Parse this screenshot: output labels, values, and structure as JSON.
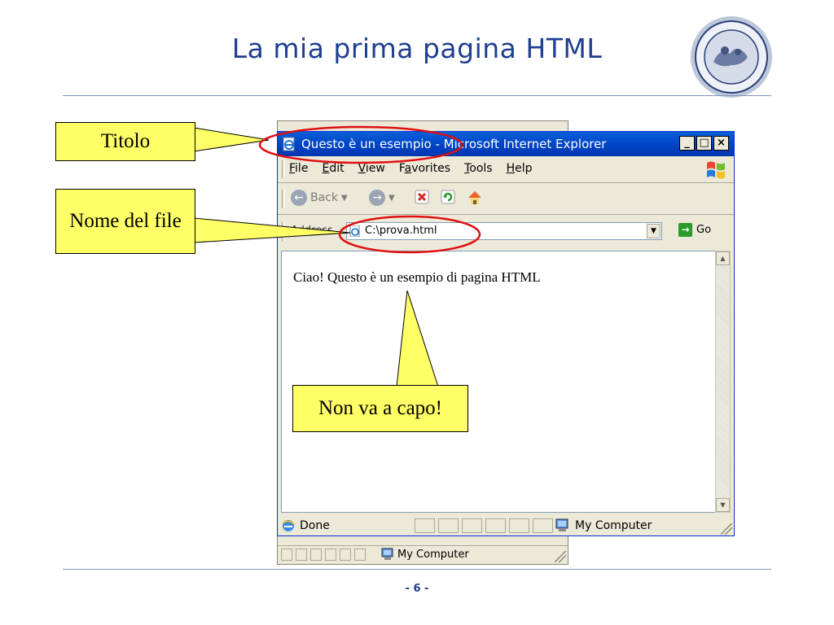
{
  "slide": {
    "title": "La mia prima pagina HTML",
    "page_number": "- 6 -"
  },
  "back_window": {
    "status_text": "My Computer"
  },
  "browser": {
    "title": "Questo è un esempio - Microsoft Internet Explorer",
    "window_buttons": {
      "minimize": "_",
      "maximize": "□",
      "close": "×"
    },
    "menu": {
      "items": [
        {
          "key": "F",
          "rest": "ile"
        },
        {
          "key": "E",
          "rest": "dit"
        },
        {
          "key": "V",
          "rest": "iew"
        },
        {
          "pre": "F",
          "key": "a",
          "rest": "vorites"
        },
        {
          "key": "T",
          "rest": "ools"
        },
        {
          "key": "H",
          "rest": "elp"
        }
      ]
    },
    "toolbar": {
      "back_label": "Back"
    },
    "address": {
      "label": "Address",
      "value": "C:\\prova.html",
      "go_label": "Go"
    },
    "content_text": "Ciao! Questo è un esempio di pagina HTML",
    "status": {
      "left": "Done",
      "right": "My Computer"
    }
  },
  "callouts": {
    "title": "Titolo",
    "filename": "Nome del file",
    "nowrap": "Non va a capo!"
  },
  "colors": {
    "callout_fill": "#ffff66",
    "highlight_ellipse": "#e01010",
    "title_blue": "#1f3f8f"
  }
}
